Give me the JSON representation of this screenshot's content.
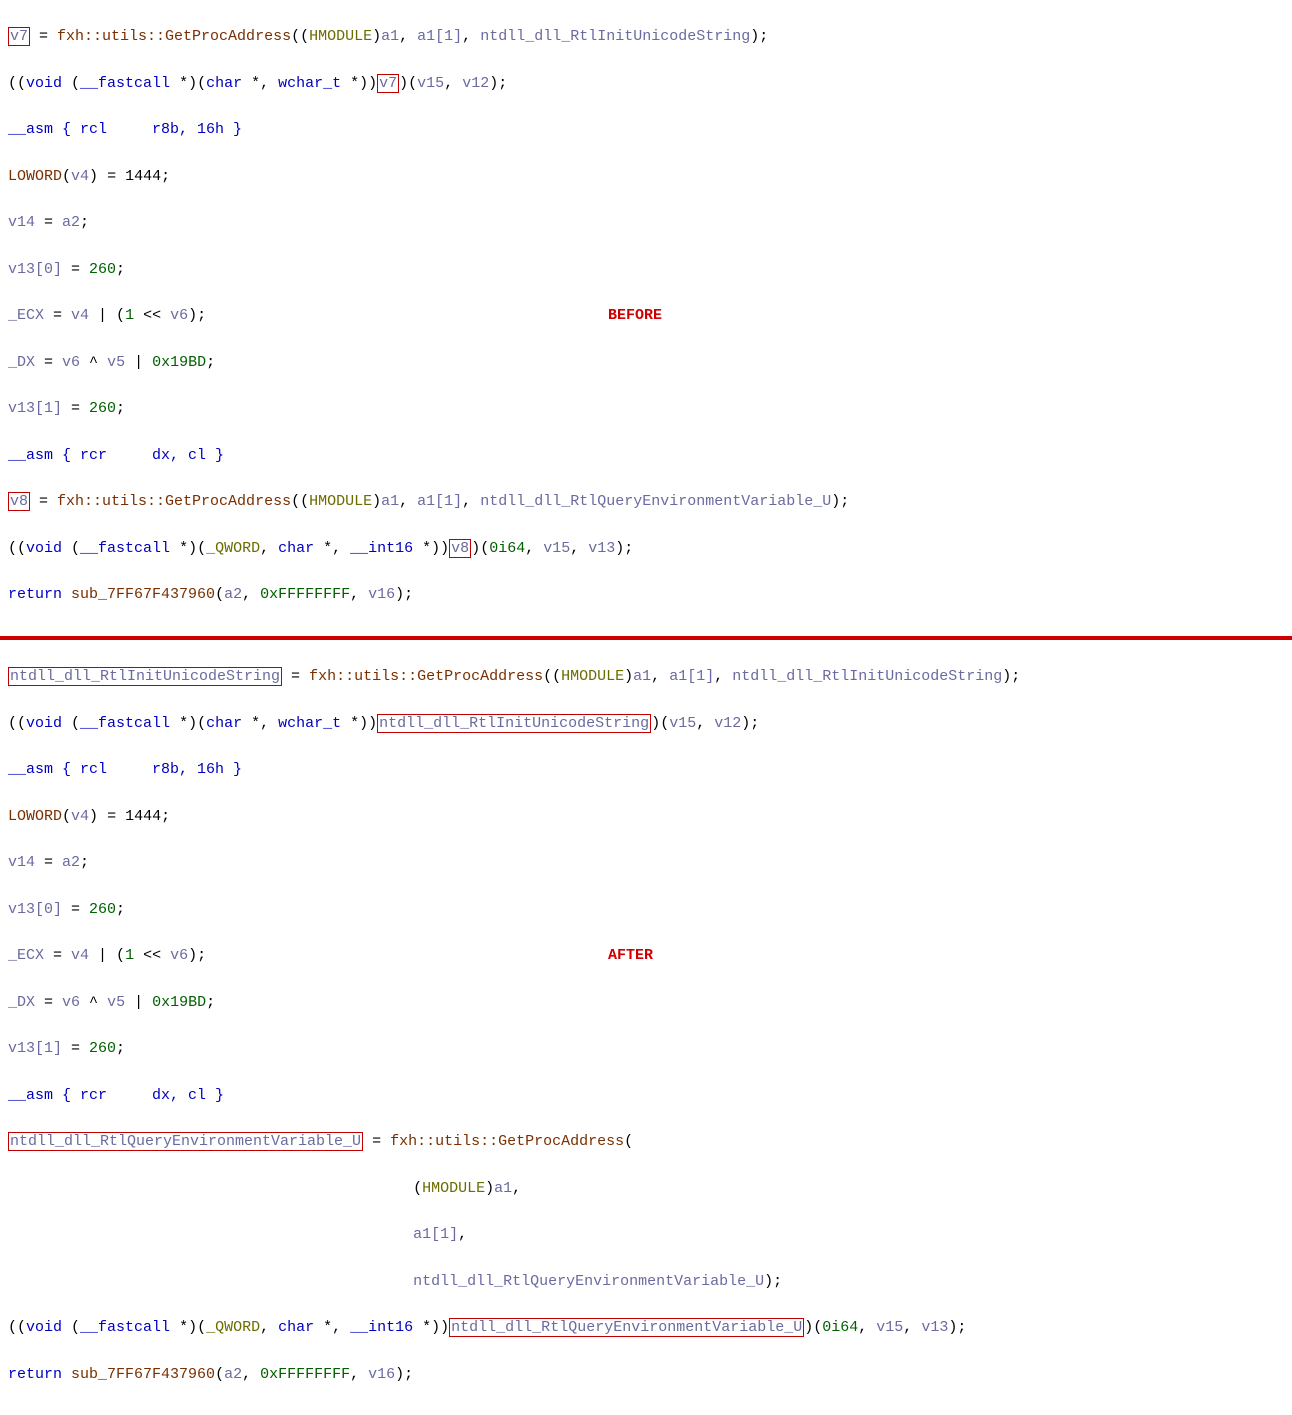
{
  "labels": {
    "before": "BEFORE",
    "after": "AFTER"
  },
  "before": {
    "l1": {
      "v7": "v7",
      "call": "fxh::utils::GetProcAddress",
      "hmod": "HMODULE",
      "a1": "a1",
      "a1idx": "a1[1]",
      "sym": "ntdll_dll_RtlInitUnicodeString"
    },
    "l2": {
      "cast": "void (__fastcall *)(char *, wchar_t *)",
      "v7": "v7",
      "v15": "v15",
      "v12": "v12"
    },
    "l3": {
      "text": "__asm { rcl     r8b, 16h }"
    },
    "l4": {
      "loword": "LOWORD",
      "v4": "v4",
      "eq": "= 1444;"
    },
    "l5": {
      "v14": "v14",
      "a2": "a2"
    },
    "l6": {
      "v13": "v13[0]",
      "n": "260"
    },
    "l7": {
      "ecx": "_ECX",
      "v4": "v4",
      "one": "1",
      "v6": "v6"
    },
    "l8": {
      "dx": "_DX",
      "v6": "v6",
      "v5": "v5",
      "hex": "0x19BD"
    },
    "l9": {
      "v13": "v13[1]",
      "n": "260"
    },
    "l10": {
      "text": "__asm { rcr     dx, cl }"
    },
    "l11": {
      "v8": "v8",
      "call": "fxh::utils::GetProcAddress",
      "hmod": "HMODULE",
      "a1": "a1",
      "a1idx": "a1[1]",
      "sym": "ntdll_dll_RtlQueryEnvironmentVariable_U"
    },
    "l12": {
      "cast": "void (__fastcall *)(_QWORD, char *, __int16 *)",
      "v8": "v8",
      "zero": "0i64",
      "v15": "v15",
      "v13": "v13"
    },
    "l13": {
      "ret": "return",
      "sub": "sub_7FF67F437960",
      "a2": "a2",
      "ff": "0xFFFFFFFF",
      "v16": "v16"
    }
  },
  "after": {
    "l1": {
      "sym": "ntdll_dll_RtlInitUnicodeString",
      "call": "fxh::utils::GetProcAddress",
      "hmod": "HMODULE",
      "a1": "a1",
      "a1idx": "a1[1]",
      "sym2": "ntdll_dll_RtlInitUnicodeString"
    },
    "l2": {
      "cast": "void (__fastcall *)(char *, wchar_t *)",
      "sym": "ntdll_dll_RtlInitUnicodeString",
      "v15": "v15",
      "v12": "v12"
    },
    "l3": {
      "text": "__asm { rcl     r8b, 16h }"
    },
    "l4": {
      "loword": "LOWORD",
      "v4": "v4",
      "eq": "= 1444;"
    },
    "l5": {
      "v14": "v14",
      "a2": "a2"
    },
    "l6": {
      "v13": "v13[0]",
      "n": "260"
    },
    "l7": {
      "ecx": "_ECX",
      "v4": "v4",
      "one": "1",
      "v6": "v6"
    },
    "l8": {
      "dx": "_DX",
      "v6": "v6",
      "v5": "v5",
      "hex": "0x19BD"
    },
    "l9": {
      "v13": "v13[1]",
      "n": "260"
    },
    "l10": {
      "text": "__asm { rcr     dx, cl }"
    },
    "l11": {
      "sym": "ntdll_dll_RtlQueryEnvironmentVariable_U",
      "call": "fxh::utils::GetProcAddress"
    },
    "l12": {
      "hmod": "HMODULE",
      "a1": "a1"
    },
    "l13": {
      "a1idx": "a1[1]"
    },
    "l14": {
      "sym": "ntdll_dll_RtlQueryEnvironmentVariable_U"
    },
    "l15": {
      "cast": "void (__fastcall *)(_QWORD, char *, __int16 *)",
      "sym": "ntdll_dll_RtlQueryEnvironmentVariable_U",
      "zero": "0i64",
      "v15": "v15",
      "v13": "v13"
    },
    "l16": {
      "ret": "return",
      "sub": "sub_7FF67F437960",
      "a2": "a2",
      "ff": "0xFFFFFFFF",
      "v16": "v16"
    }
  }
}
